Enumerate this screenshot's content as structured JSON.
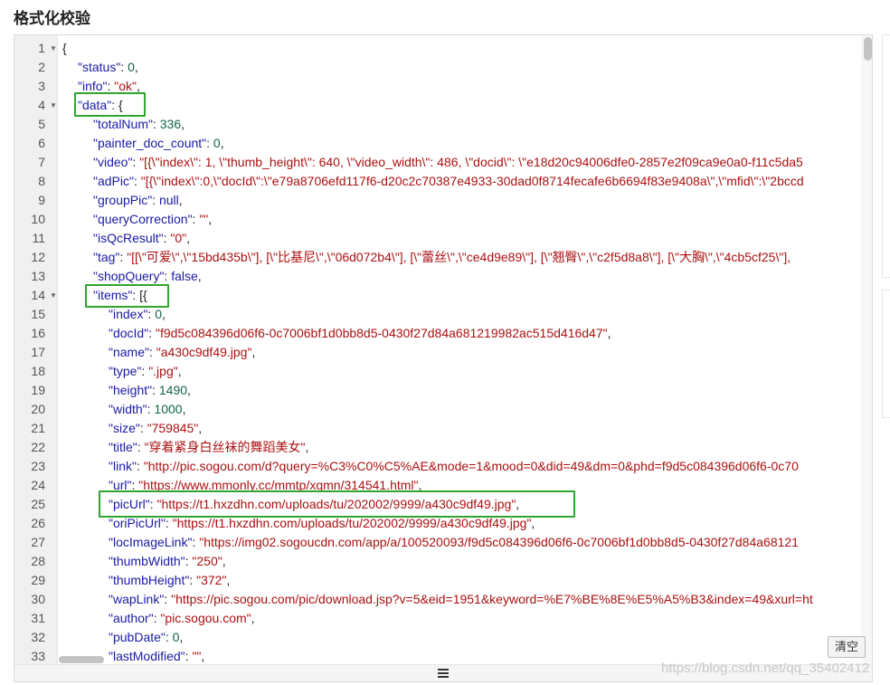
{
  "page": {
    "title": "格式化校验",
    "clear_label": "清空",
    "watermark": "https://blog.csdn.net/qq_35402412"
  },
  "editor": {
    "lines": [
      {
        "n": "1",
        "fold": true,
        "indent": 0,
        "parts": [
          {
            "t": "p",
            "v": "{"
          }
        ]
      },
      {
        "n": "2",
        "indent": 1,
        "parts": [
          {
            "t": "k",
            "v": "\"status\""
          },
          {
            "t": "p",
            "v": ": "
          },
          {
            "t": "n",
            "v": "0"
          },
          {
            "t": "p",
            "v": ","
          }
        ]
      },
      {
        "n": "3",
        "indent": 1,
        "parts": [
          {
            "t": "k",
            "v": "\"info\""
          },
          {
            "t": "p",
            "v": ": "
          },
          {
            "t": "s",
            "v": "\"ok\""
          },
          {
            "t": "p",
            "v": ","
          }
        ]
      },
      {
        "n": "4",
        "fold": true,
        "indent": 1,
        "parts": [
          {
            "t": "k",
            "v": "\"data\""
          },
          {
            "t": "p",
            "v": ": {"
          }
        ]
      },
      {
        "n": "5",
        "indent": 2,
        "parts": [
          {
            "t": "k",
            "v": "\"totalNum\""
          },
          {
            "t": "p",
            "v": ": "
          },
          {
            "t": "n",
            "v": "336"
          },
          {
            "t": "p",
            "v": ","
          }
        ]
      },
      {
        "n": "6",
        "indent": 2,
        "parts": [
          {
            "t": "k",
            "v": "\"painter_doc_count\""
          },
          {
            "t": "p",
            "v": ": "
          },
          {
            "t": "n",
            "v": "0"
          },
          {
            "t": "p",
            "v": ","
          }
        ]
      },
      {
        "n": "7",
        "indent": 2,
        "parts": [
          {
            "t": "k",
            "v": "\"video\""
          },
          {
            "t": "p",
            "v": ": "
          },
          {
            "t": "s",
            "v": "\"[{\\\"index\\\": 1, \\\"thumb_height\\\": 640, \\\"video_width\\\": 486, \\\"docid\\\": \\\"e18d20c94006dfe0-2857e2f09ca9e0a0-f11c5da5"
          }
        ]
      },
      {
        "n": "8",
        "indent": 2,
        "parts": [
          {
            "t": "k",
            "v": "\"adPic\""
          },
          {
            "t": "p",
            "v": ": "
          },
          {
            "t": "s",
            "v": "\"[{\\\"index\\\":0,\\\"docId\\\":\\\"e79a8706efd117f6-d20c2c70387e4933-30dad0f8714fecafe6b6694f83e9408a\\\",\\\"mfid\\\":\\\"2bccd"
          }
        ]
      },
      {
        "n": "9",
        "indent": 2,
        "parts": [
          {
            "t": "k",
            "v": "\"groupPic\""
          },
          {
            "t": "p",
            "v": ": "
          },
          {
            "t": "kw",
            "v": "null"
          },
          {
            "t": "p",
            "v": ","
          }
        ]
      },
      {
        "n": "10",
        "indent": 2,
        "parts": [
          {
            "t": "k",
            "v": "\"queryCorrection\""
          },
          {
            "t": "p",
            "v": ": "
          },
          {
            "t": "s",
            "v": "\"\""
          },
          {
            "t": "p",
            "v": ","
          }
        ]
      },
      {
        "n": "11",
        "indent": 2,
        "parts": [
          {
            "t": "k",
            "v": "\"isQcResult\""
          },
          {
            "t": "p",
            "v": ": "
          },
          {
            "t": "s",
            "v": "\"0\""
          },
          {
            "t": "p",
            "v": ","
          }
        ]
      },
      {
        "n": "12",
        "indent": 2,
        "parts": [
          {
            "t": "k",
            "v": "\"tag\""
          },
          {
            "t": "p",
            "v": ": "
          },
          {
            "t": "s",
            "v": "\"[[\\\"可爱\\\",\\\"15bd435b\\\"], [\\\"比基尼\\\",\\\"06d072b4\\\"], [\\\"蕾丝\\\",\\\"ce4d9e89\\\"], [\\\"翘臀\\\",\\\"c2f5d8a8\\\"], [\\\"大胸\\\",\\\"4cb5cf25\\\"],"
          }
        ]
      },
      {
        "n": "13",
        "indent": 2,
        "parts": [
          {
            "t": "k",
            "v": "\"shopQuery\""
          },
          {
            "t": "p",
            "v": ": "
          },
          {
            "t": "kw",
            "v": "false"
          },
          {
            "t": "p",
            "v": ","
          }
        ]
      },
      {
        "n": "14",
        "fold": true,
        "indent": 2,
        "parts": [
          {
            "t": "k",
            "v": "\"items\""
          },
          {
            "t": "p",
            "v": ": [{"
          }
        ]
      },
      {
        "n": "15",
        "indent": 3,
        "parts": [
          {
            "t": "k",
            "v": "\"index\""
          },
          {
            "t": "p",
            "v": ": "
          },
          {
            "t": "n",
            "v": "0"
          },
          {
            "t": "p",
            "v": ","
          }
        ]
      },
      {
        "n": "16",
        "indent": 3,
        "parts": [
          {
            "t": "k",
            "v": "\"docId\""
          },
          {
            "t": "p",
            "v": ": "
          },
          {
            "t": "s",
            "v": "\"f9d5c084396d06f6-0c7006bf1d0bb8d5-0430f27d84a681219982ac515d416d47\""
          },
          {
            "t": "p",
            "v": ","
          }
        ]
      },
      {
        "n": "17",
        "indent": 3,
        "parts": [
          {
            "t": "k",
            "v": "\"name\""
          },
          {
            "t": "p",
            "v": ": "
          },
          {
            "t": "s",
            "v": "\"a430c9df49.jpg\""
          },
          {
            "t": "p",
            "v": ","
          }
        ]
      },
      {
        "n": "18",
        "indent": 3,
        "parts": [
          {
            "t": "k",
            "v": "\"type\""
          },
          {
            "t": "p",
            "v": ": "
          },
          {
            "t": "s",
            "v": "\".jpg\""
          },
          {
            "t": "p",
            "v": ","
          }
        ]
      },
      {
        "n": "19",
        "indent": 3,
        "parts": [
          {
            "t": "k",
            "v": "\"height\""
          },
          {
            "t": "p",
            "v": ": "
          },
          {
            "t": "n",
            "v": "1490"
          },
          {
            "t": "p",
            "v": ","
          }
        ]
      },
      {
        "n": "20",
        "indent": 3,
        "parts": [
          {
            "t": "k",
            "v": "\"width\""
          },
          {
            "t": "p",
            "v": ": "
          },
          {
            "t": "n",
            "v": "1000"
          },
          {
            "t": "p",
            "v": ","
          }
        ]
      },
      {
        "n": "21",
        "indent": 3,
        "parts": [
          {
            "t": "k",
            "v": "\"size\""
          },
          {
            "t": "p",
            "v": ": "
          },
          {
            "t": "s",
            "v": "\"759845\""
          },
          {
            "t": "p",
            "v": ","
          }
        ]
      },
      {
        "n": "22",
        "indent": 3,
        "parts": [
          {
            "t": "k",
            "v": "\"title\""
          },
          {
            "t": "p",
            "v": ": "
          },
          {
            "t": "s",
            "v": "\"穿着紧身白丝袜的舞蹈美女\""
          },
          {
            "t": "p",
            "v": ","
          }
        ]
      },
      {
        "n": "23",
        "indent": 3,
        "parts": [
          {
            "t": "k",
            "v": "\"link\""
          },
          {
            "t": "p",
            "v": ": "
          },
          {
            "t": "s",
            "v": "\"http://pic.sogou.com/d?query=%C3%C0%C5%AE&mode=1&mood=0&did=49&dm=0&phd=f9d5c084396d06f6-0c70"
          }
        ]
      },
      {
        "n": "24",
        "indent": 3,
        "parts": [
          {
            "t": "k",
            "v": "\"url\""
          },
          {
            "t": "p",
            "v": ": "
          },
          {
            "t": "s",
            "v": "\"https://www.mmonly.cc/mmtp/xgmn/314541.html\""
          },
          {
            "t": "p",
            "v": ","
          }
        ]
      },
      {
        "n": "25",
        "indent": 3,
        "parts": [
          {
            "t": "k",
            "v": "\"picUrl\""
          },
          {
            "t": "p",
            "v": ": "
          },
          {
            "t": "s",
            "v": "\"https://t1.hxzdhn.com/uploads/tu/202002/9999/a430c9df49.jpg\""
          },
          {
            "t": "p",
            "v": ","
          }
        ]
      },
      {
        "n": "26",
        "indent": 3,
        "parts": [
          {
            "t": "k",
            "v": "\"oriPicUrl\""
          },
          {
            "t": "p",
            "v": ": "
          },
          {
            "t": "s",
            "v": "\"https://t1.hxzdhn.com/uploads/tu/202002/9999/a430c9df49.jpg\""
          },
          {
            "t": "p",
            "v": ","
          }
        ]
      },
      {
        "n": "27",
        "indent": 3,
        "parts": [
          {
            "t": "k",
            "v": "\"locImageLink\""
          },
          {
            "t": "p",
            "v": ": "
          },
          {
            "t": "s",
            "v": "\"https://img02.sogoucdn.com/app/a/100520093/f9d5c084396d06f6-0c7006bf1d0bb8d5-0430f27d84a68121"
          }
        ]
      },
      {
        "n": "28",
        "indent": 3,
        "parts": [
          {
            "t": "k",
            "v": "\"thumbWidth\""
          },
          {
            "t": "p",
            "v": ": "
          },
          {
            "t": "s",
            "v": "\"250\""
          },
          {
            "t": "p",
            "v": ","
          }
        ]
      },
      {
        "n": "29",
        "indent": 3,
        "parts": [
          {
            "t": "k",
            "v": "\"thumbHeight\""
          },
          {
            "t": "p",
            "v": ": "
          },
          {
            "t": "s",
            "v": "\"372\""
          },
          {
            "t": "p",
            "v": ","
          }
        ]
      },
      {
        "n": "30",
        "indent": 3,
        "parts": [
          {
            "t": "k",
            "v": "\"wapLink\""
          },
          {
            "t": "p",
            "v": ": "
          },
          {
            "t": "s",
            "v": "\"https://pic.sogou.com/pic/download.jsp?v=5&eid=1951&keyword=%E7%BE%8E%E5%A5%B3&index=49&xurl=ht"
          }
        ]
      },
      {
        "n": "31",
        "indent": 3,
        "parts": [
          {
            "t": "k",
            "v": "\"author\""
          },
          {
            "t": "p",
            "v": ": "
          },
          {
            "t": "s",
            "v": "\"pic.sogou.com\""
          },
          {
            "t": "p",
            "v": ","
          }
        ]
      },
      {
        "n": "32",
        "indent": 3,
        "parts": [
          {
            "t": "k",
            "v": "\"pubDate\""
          },
          {
            "t": "p",
            "v": ": "
          },
          {
            "t": "n",
            "v": "0"
          },
          {
            "t": "p",
            "v": ","
          }
        ]
      },
      {
        "n": "33",
        "indent": 3,
        "parts": [
          {
            "t": "k",
            "v": "\"lastModified\""
          },
          {
            "t": "p",
            "v": ": "
          },
          {
            "t": "s",
            "v": "\"\""
          },
          {
            "t": "p",
            "v": ","
          }
        ]
      }
    ]
  },
  "colors": {
    "highlight_box": "#2ea52e",
    "key": "#1a1aa6",
    "string": "#aa1111",
    "number": "#116644"
  }
}
